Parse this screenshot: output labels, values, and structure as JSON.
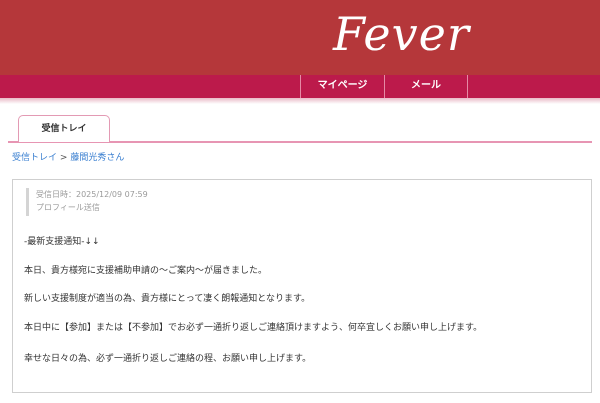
{
  "brand": {
    "logo_text": "Fever"
  },
  "nav": {
    "items": [
      "マイページ",
      "メール"
    ]
  },
  "tabs": {
    "inbox_label": "受信トレイ"
  },
  "breadcrumb": {
    "root": "受信トレイ",
    "separator": ">",
    "current": "藤間光秀さん"
  },
  "message": {
    "received_label": "受信日時：2025/12/09 07:59",
    "type_label": "プロフィール送信",
    "lines": [
      "-最新支援通知-↓↓",
      "本日、貴方様宛に支援補助申請の〜ご案内〜が届きました。",
      "新しい支援制度が適当の為、貴方様にとって凄く朗報通知となります。",
      "本日中に【参加】または【不参加】でお必ず一通折り返しご連絡頂けますよう、何卒宜しくお願い申し上げます。",
      "幸せな日々の為、必ず一通折り返しご連絡の程、お願い申し上げます。"
    ]
  },
  "colors": {
    "header": "#b5373a",
    "navbar": "#bc1a4b",
    "accent_pink": "#e795b3",
    "link": "#3a7fd0"
  }
}
